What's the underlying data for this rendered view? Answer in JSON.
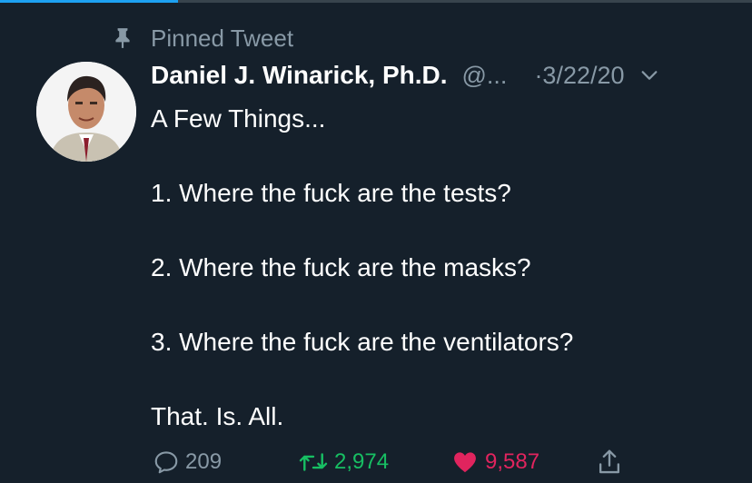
{
  "colors": {
    "background": "#15202b",
    "secondary_text": "#8899a6",
    "retweet_green": "#17bf63",
    "like_red": "#e0245e",
    "accent_blue": "#1da1f2"
  },
  "pinned": {
    "icon": "pin-icon",
    "label": "Pinned Tweet"
  },
  "tweet": {
    "author_name": "Daniel J. Winarick, Ph.D.",
    "handle": "@...",
    "date": "·3/22/20",
    "lines": [
      "A Few Things...",
      "",
      "1. Where the fuck are the tests?",
      "",
      "2. Where the fuck are the masks?",
      "",
      "3. Where the fuck are the ventilators?",
      "",
      "That. Is. All."
    ]
  },
  "actions": {
    "replies": "209",
    "retweets": "2,974",
    "likes": "9,587"
  }
}
